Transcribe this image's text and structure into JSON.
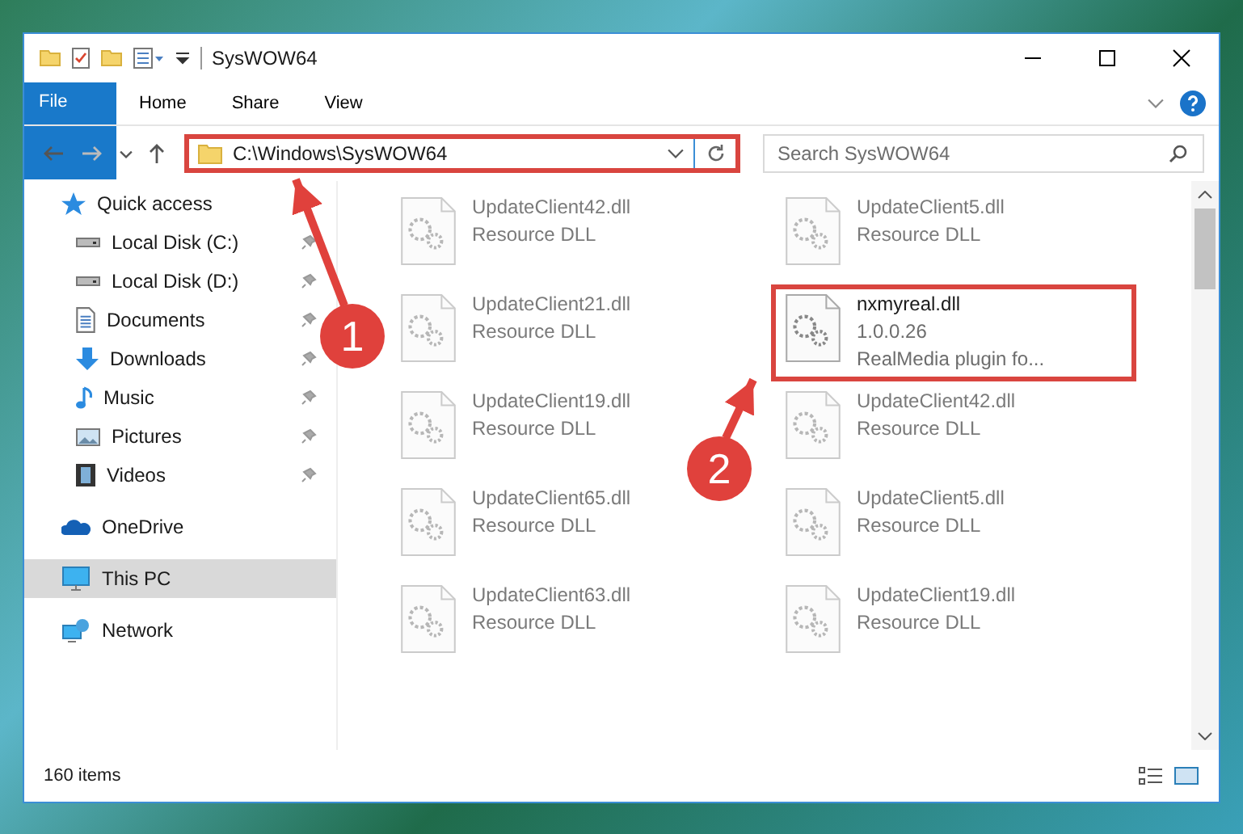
{
  "window": {
    "title": "SysWOW64"
  },
  "ribbon_tabs": [
    {
      "label": "File",
      "kind": "file"
    },
    {
      "label": "Home",
      "kind": "tab"
    },
    {
      "label": "Share",
      "kind": "tab"
    },
    {
      "label": "View",
      "kind": "tab"
    }
  ],
  "address": {
    "path": "C:\\Windows\\SysWOW64",
    "highlighted": true
  },
  "search": {
    "placeholder": "Search SysWOW64"
  },
  "sidebar": [
    {
      "label": "Quick access",
      "kind": "star",
      "selected": false,
      "children": [
        {
          "label": "Local Disk (C:)",
          "kind": "disk",
          "pinned": true,
          "selected": false
        },
        {
          "label": "Local Disk (D:)",
          "kind": "disk",
          "pinned": true,
          "selected": false
        },
        {
          "label": "Documents",
          "kind": "doc",
          "pinned": true,
          "selected": false
        },
        {
          "label": "Downloads",
          "kind": "download",
          "pinned": true,
          "selected": false
        },
        {
          "label": "Music",
          "kind": "music",
          "pinned": true,
          "selected": false
        },
        {
          "label": "Pictures",
          "kind": "picture",
          "pinned": true,
          "selected": false
        },
        {
          "label": "Videos",
          "kind": "video",
          "pinned": true,
          "selected": false
        }
      ]
    },
    {
      "label": "OneDrive",
      "kind": "cloud",
      "selected": false
    },
    {
      "label": "This PC",
      "kind": "pc",
      "selected": true
    },
    {
      "label": "Network",
      "kind": "network",
      "selected": false
    }
  ],
  "files": [
    {
      "name": "UpdateClient42.dll",
      "details": [
        "Resource DLL"
      ],
      "dimmed": true,
      "highlighted": false
    },
    {
      "name": "UpdateClient5.dll",
      "details": [
        "Resource DLL"
      ],
      "dimmed": true,
      "highlighted": false
    },
    {
      "name": "UpdateClient21.dll",
      "details": [
        "Resource DLL"
      ],
      "dimmed": true,
      "highlighted": false
    },
    {
      "name": "nxmyreal.dll",
      "details": [
        "1.0.0.26",
        "RealMedia plugin fo..."
      ],
      "dimmed": false,
      "highlighted": true
    },
    {
      "name": "UpdateClient19.dll",
      "details": [
        "Resource DLL"
      ],
      "dimmed": true,
      "highlighted": false
    },
    {
      "name": "UpdateClient42.dll",
      "details": [
        "Resource DLL"
      ],
      "dimmed": true,
      "highlighted": false
    },
    {
      "name": "UpdateClient65.dll",
      "details": [
        "Resource DLL"
      ],
      "dimmed": true,
      "highlighted": false
    },
    {
      "name": "UpdateClient5.dll",
      "details": [
        "Resource DLL"
      ],
      "dimmed": true,
      "highlighted": false
    },
    {
      "name": "UpdateClient63.dll",
      "details": [
        "Resource DLL"
      ],
      "dimmed": true,
      "highlighted": false
    },
    {
      "name": "UpdateClient19.dll",
      "details": [
        "Resource DLL"
      ],
      "dimmed": true,
      "highlighted": false
    }
  ],
  "status_bar": {
    "item_count": "160 items"
  },
  "callouts": [
    {
      "number": "1"
    },
    {
      "number": "2"
    }
  ]
}
